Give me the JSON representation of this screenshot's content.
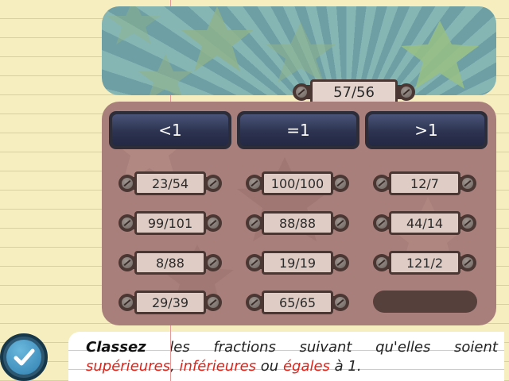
{
  "score": "57/56",
  "categories": [
    {
      "label": "<1"
    },
    {
      "label": "=1"
    },
    {
      "label": ">1"
    }
  ],
  "fractions": [
    [
      "23/54",
      "100/100",
      "12/7"
    ],
    [
      "99/101",
      "88/88",
      "44/14"
    ],
    [
      "8/88",
      "19/19",
      "121/2"
    ],
    [
      "29/39",
      "65/65",
      ""
    ]
  ],
  "instruction": {
    "w1": "Classez",
    "w2": "les",
    "w3": "fractions",
    "w4": "suivant",
    "w5": "qu'elles",
    "w6": "soient",
    "sup": "supérieures",
    "comma": ",",
    "inf": "inférieures",
    "ou": "ou",
    "egales": "égales",
    "tail": "à 1."
  },
  "colors": {
    "paper": "#f7eec0",
    "board": "#a97f7b",
    "category_button": "#2c3350",
    "highlight_red": "#e2231a"
  },
  "icons": {
    "check": "check-icon",
    "screw": "screw-icon"
  }
}
